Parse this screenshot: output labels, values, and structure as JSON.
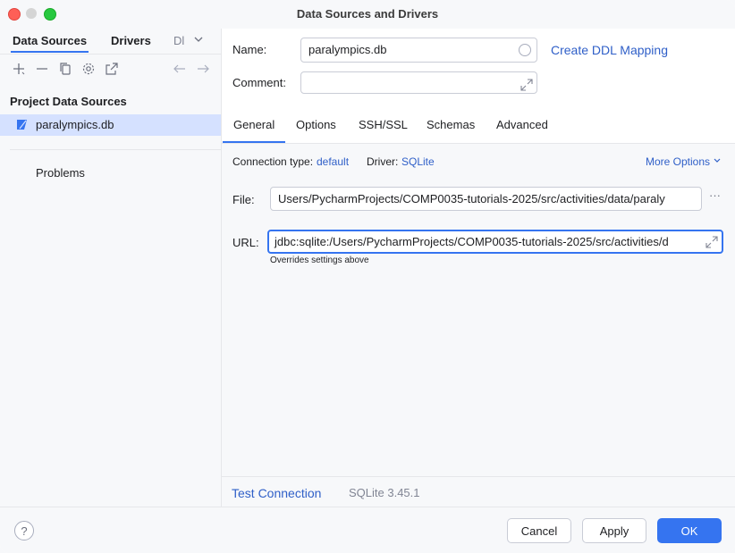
{
  "window": {
    "title": "Data Sources and Drivers"
  },
  "left": {
    "tabs": [
      {
        "label": "Data Sources"
      },
      {
        "label": "Drivers"
      },
      {
        "label": "Dl"
      }
    ],
    "section_header": "Project Data Sources",
    "data_sources": [
      {
        "label": "paralympics.db"
      }
    ],
    "problems_label": "Problems"
  },
  "right": {
    "name_label": "Name:",
    "name_value": "paralympics.db",
    "create_ddl_link": "Create DDL Mapping",
    "comment_label": "Comment:",
    "comment_value": "",
    "tabs": [
      {
        "label": "General"
      },
      {
        "label": "Options"
      },
      {
        "label": "SSH/SSL"
      },
      {
        "label": "Schemas"
      },
      {
        "label": "Advanced"
      }
    ],
    "connection_type_label": "Connection type:",
    "connection_type_value": "default",
    "driver_label": "Driver:",
    "driver_value": "SQLite",
    "more_options": "More Options",
    "file_label": "File:",
    "file_value": "Users/PycharmProjects/COMP0035-tutorials-2025/src/activities/data/paraly",
    "url_label": "URL:",
    "url_value": "jdbc:sqlite:/Users/PycharmProjects/COMP0035-tutorials-2025/src/activities/d",
    "url_hint": "Overrides settings above",
    "test_connection": "Test Connection",
    "sqlite_version": "SQLite 3.45.1"
  },
  "footer": {
    "help": "?",
    "cancel": "Cancel",
    "apply": "Apply",
    "ok": "OK"
  },
  "colors": {
    "accent": "#3574f0",
    "link": "#2f5fc8",
    "selection": "#d5e1ff"
  }
}
